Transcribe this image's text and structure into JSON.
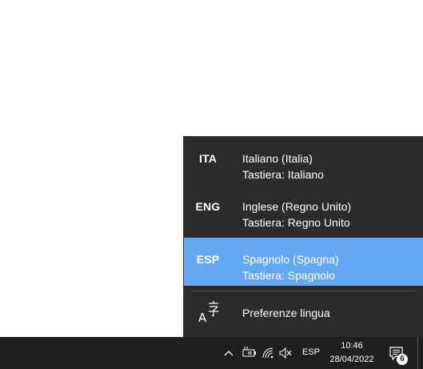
{
  "language_flyout": {
    "languages": [
      {
        "code": "ITA",
        "name": "Italiano (Italia)",
        "keyboard": "Tastiera: Italiano",
        "selected": false
      },
      {
        "code": "ENG",
        "name": "Inglese (Regno Unito)",
        "keyboard": "Tastiera: Regno Unito",
        "selected": false
      },
      {
        "code": "ESP",
        "name": "Spagnolo (Spagna)",
        "keyboard": "Tastiera: Spagnolo",
        "selected": true
      }
    ],
    "preferences_label": "Preferenze lingua",
    "preferences_icon": "language-settings-icon",
    "selected_color": "#64a8f3",
    "background_color": "#2b2b2b"
  },
  "taskbar": {
    "input_indicator": "ESP",
    "time": "10:46",
    "date": "28/04/2022",
    "notification_count": "6",
    "icons": [
      "chevron-up-icon",
      "battery-plugged-icon",
      "wifi-icon",
      "speaker-muted-icon",
      "action-center-icon"
    ],
    "background_color": "#1f1f1f"
  }
}
